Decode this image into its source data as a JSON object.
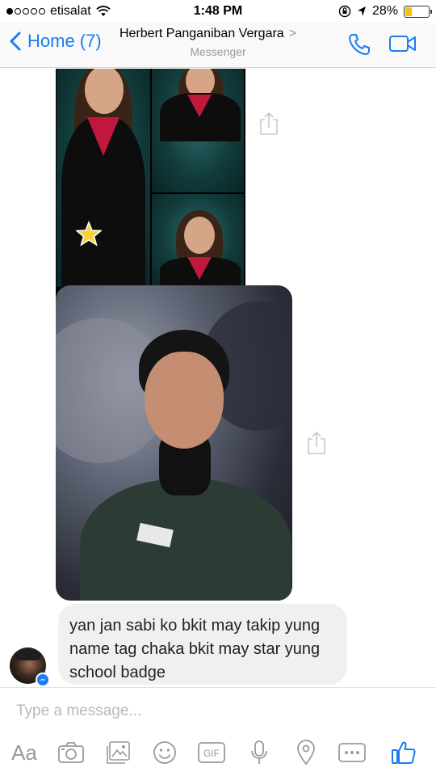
{
  "status_bar": {
    "carrier": "etisalat",
    "time": "1:48 PM",
    "battery": "28%",
    "battery_level": 0.28,
    "signal_bars_filled": 1,
    "signal_bars_total": 5
  },
  "header": {
    "back_label": "Home (7)",
    "contact_name": "Herbert Panganiban Vergara",
    "subtitle": "Messenger",
    "chevron": ">"
  },
  "messages": [
    {
      "type": "image",
      "description_icon": "photo-collage"
    },
    {
      "type": "image",
      "description_icon": "photo-portrait"
    },
    {
      "type": "text",
      "text": "yan jan sabi ko bkit may takip yung name tag chaka bkit may star yung school badge"
    }
  ],
  "composer": {
    "placeholder": "Type a message...",
    "aa_label": "Aa",
    "icons": [
      "camera-icon",
      "gallery-icon",
      "emoji-icon",
      "gif-icon",
      "microphone-icon",
      "location-icon",
      "more-icon",
      "like-icon"
    ]
  },
  "colors": {
    "accent": "#1a7cf2",
    "bubble_bg": "#f1f0f0",
    "icon_gray": "#9a9a9a",
    "battery": "#f5c400"
  }
}
